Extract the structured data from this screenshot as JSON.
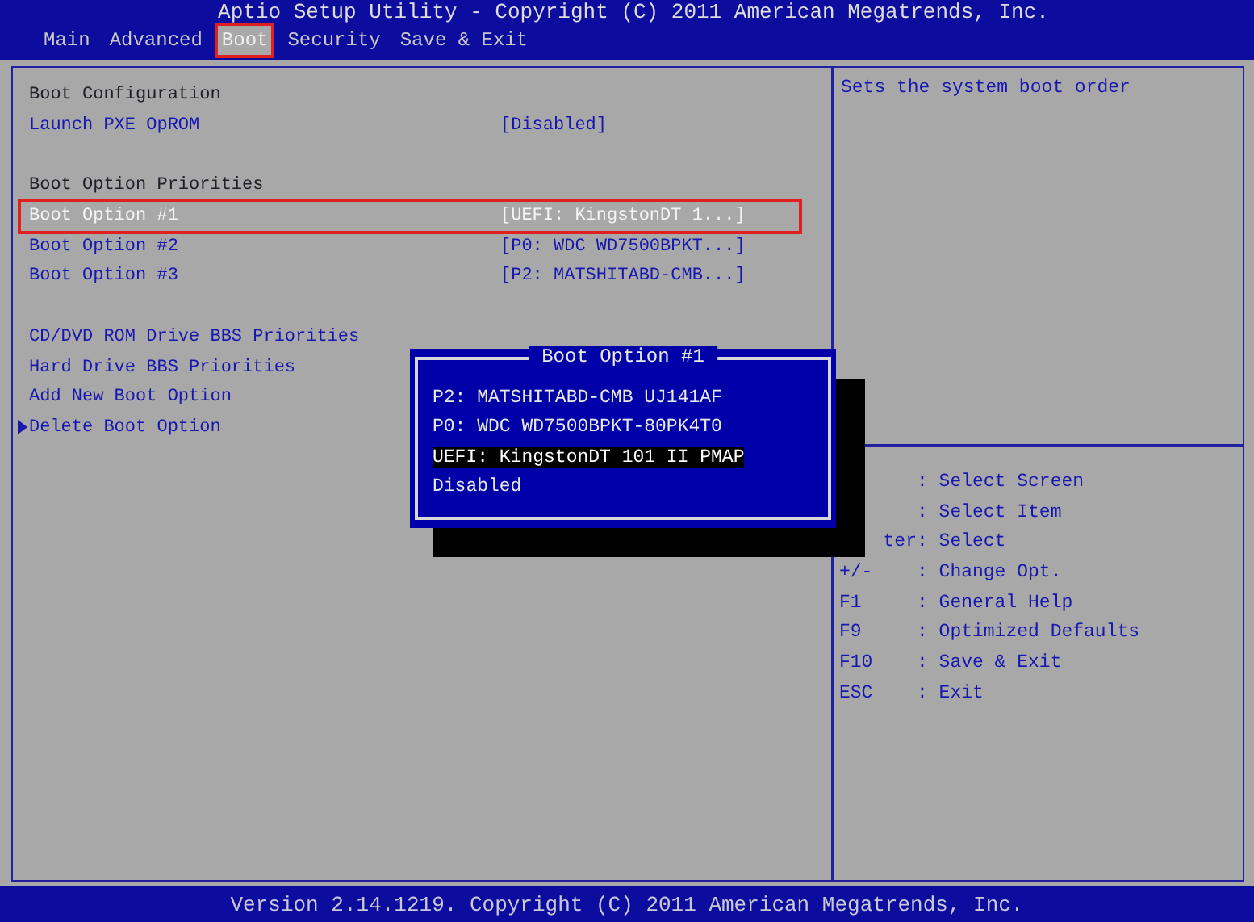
{
  "window": {
    "title": "Aptio Setup Utility - Copyright (C) 2011 American Megatrends, Inc."
  },
  "tabs": [
    {
      "label": "Main",
      "selected": false
    },
    {
      "label": "Advanced",
      "selected": false
    },
    {
      "label": "Boot",
      "selected": true
    },
    {
      "label": "Security",
      "selected": false
    },
    {
      "label": "Save & Exit",
      "selected": false
    }
  ],
  "settings": [
    {
      "kind": "heading",
      "label": "Boot Configuration"
    },
    {
      "kind": "option",
      "label": "Launch PXE OpROM",
      "value": "[Disabled]",
      "selected": false
    },
    {
      "kind": "gap"
    },
    {
      "kind": "heading",
      "label": "Boot Option Priorities"
    },
    {
      "kind": "option",
      "label": "Boot Option #1",
      "value": "[UEFI: KingstonDT 1...]",
      "selected": true
    },
    {
      "kind": "option",
      "label": "Boot Option #2",
      "value": "[P0: WDC WD7500BPKT...]",
      "selected": false
    },
    {
      "kind": "option",
      "label": "Boot Option #3",
      "value": "[P2: MATSHITABD-CMB...]",
      "selected": false
    },
    {
      "kind": "gap"
    },
    {
      "kind": "submenu",
      "label": "CD/DVD ROM Drive BBS Priorities",
      "arrow": false
    },
    {
      "kind": "submenu",
      "label": "Hard Drive BBS Priorities",
      "arrow": false
    },
    {
      "kind": "submenu",
      "label": "Add New Boot Option",
      "arrow": false
    },
    {
      "kind": "submenu",
      "label": "Delete Boot Option",
      "arrow": true
    }
  ],
  "popup": {
    "title": "Boot Option #1",
    "options": [
      {
        "label": "P2: MATSHITABD-CMB UJ141AF",
        "selected": false
      },
      {
        "label": "P0: WDC WD7500BPKT-80PK4T0",
        "selected": false
      },
      {
        "label": "UEFI: KingstonDT 101 II PMAP",
        "selected": true
      },
      {
        "label": "Disabled",
        "selected": false
      }
    ]
  },
  "help": {
    "description": "Sets the system boot order",
    "keys": [
      {
        "action": ": Select Screen"
      },
      {
        "action": ": Select Item"
      },
      {
        "key": "ter",
        "clipped": true,
        "action": ": Select"
      },
      {
        "key": "+/-",
        "clipped": false,
        "action": ": Change Opt."
      },
      {
        "key": "F1",
        "clipped": false,
        "action": ": General Help"
      },
      {
        "key": "F9",
        "clipped": false,
        "action": ": Optimized Defaults"
      },
      {
        "key": "F10",
        "clipped": false,
        "action": ": Save & Exit"
      },
      {
        "key": "ESC",
        "clipped": false,
        "action": ": Exit"
      }
    ]
  },
  "status_bar": {
    "text": "Version 2.14.1219. Copyright (C) 2011 American Megatrends, Inc."
  }
}
